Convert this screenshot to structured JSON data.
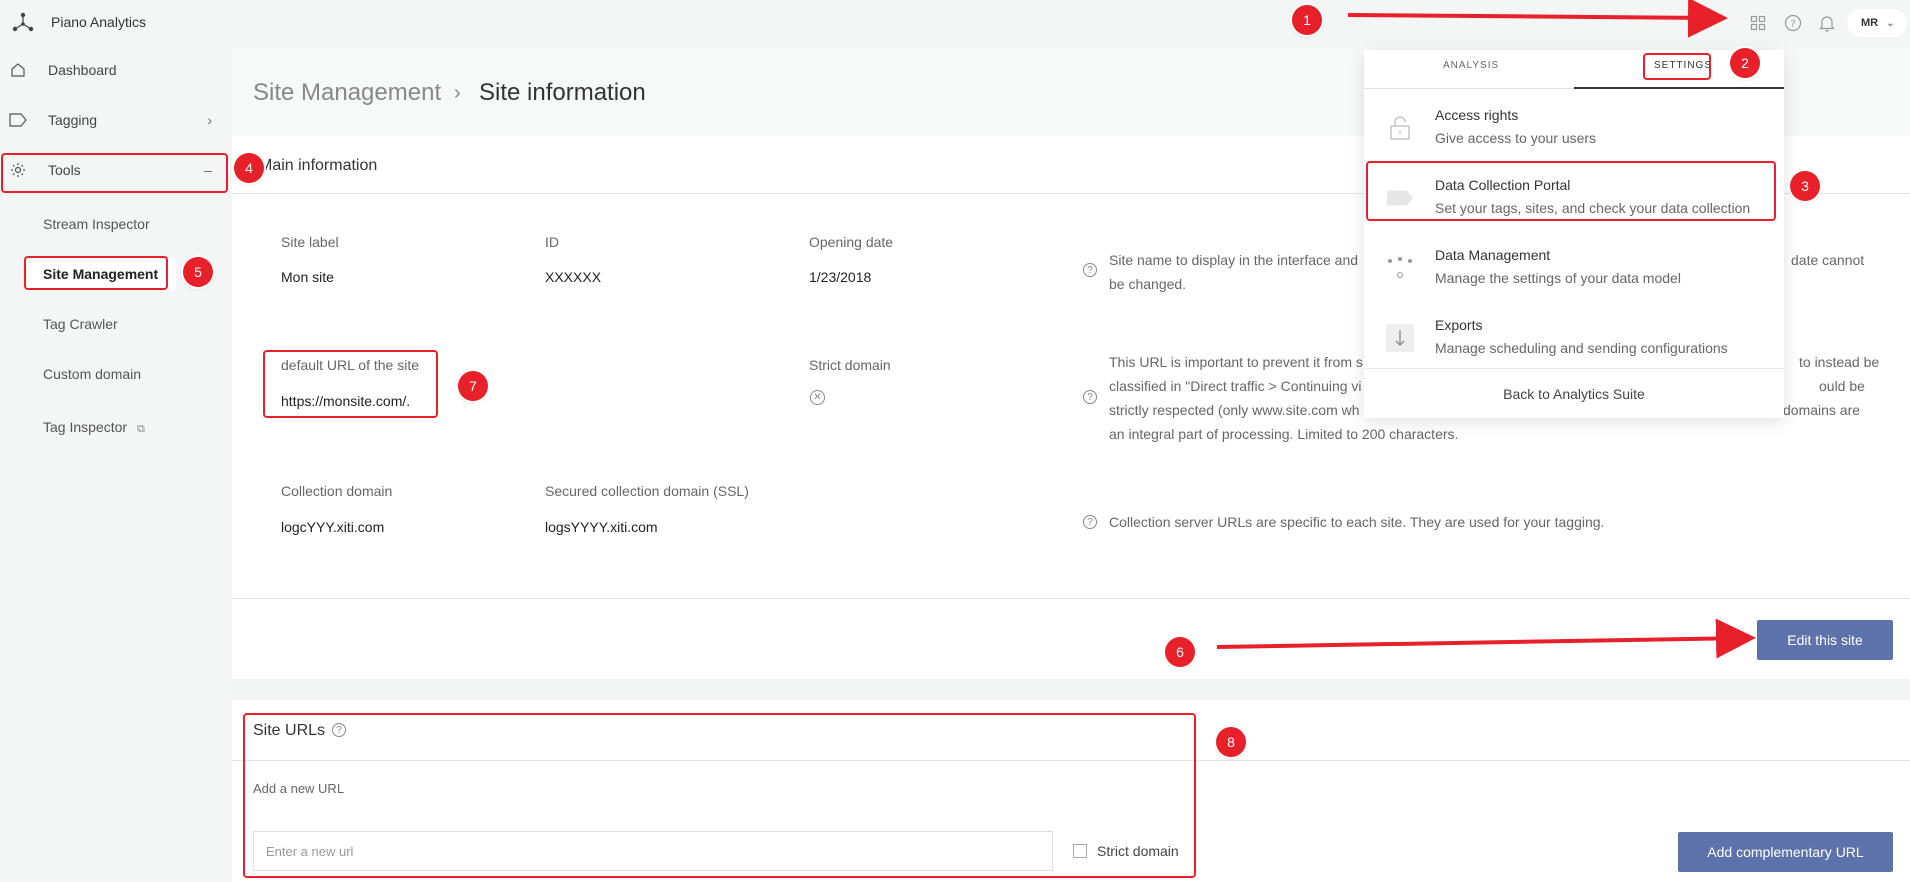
{
  "app": {
    "title": "Piano Analytics"
  },
  "topbar": {
    "icons": [
      "grid-icon",
      "help-icon",
      "bell-icon"
    ],
    "user_initials": "MR"
  },
  "sidebar": {
    "items": [
      {
        "label": "Dashboard",
        "icon": "home-icon"
      },
      {
        "label": "Tagging",
        "icon": "tag-icon",
        "right": "›"
      },
      {
        "label": "Tools",
        "icon": "gear-icon",
        "right": "–"
      }
    ],
    "sub_items": [
      {
        "label": "Stream Inspector"
      },
      {
        "label": "Site Management"
      },
      {
        "label": "Tag Crawler"
      },
      {
        "label": "Custom domain"
      },
      {
        "label": "Tag Inspector"
      }
    ]
  },
  "breadcrumb": {
    "parent": "Site Management",
    "separator": "›",
    "current": "Site information"
  },
  "main_info": {
    "title": "Main information",
    "site_label": {
      "label": "Site label",
      "value": "Mon site"
    },
    "id": {
      "label": "ID",
      "value": "XXXXXX"
    },
    "opening_date": {
      "label": "Opening date",
      "value": "1/23/2018"
    },
    "help1_line1": "Site name to display in the interface and",
    "help1_tail": "date cannot",
    "help1_line2": "be changed.",
    "default_url": {
      "label": "default URL of the site",
      "value": "https://monsite.com/."
    },
    "strict_domain_label": "Strict domain",
    "help2_lines": [
      "This URL is important to prevent it from s",
      "classified in \"Direct traffic > Continuing vi",
      "strictly respected (only www.site.com wh",
      "an integral part of processing. Limited to 200 characters."
    ],
    "help2_tails": [
      "to instead be",
      "ould be",
      "domains are"
    ],
    "collection_domain": {
      "label": "Collection domain",
      "value": "logcYYY.xiti.com"
    },
    "secured_domain": {
      "label": "Secured collection domain (SSL)",
      "value": "logsYYYY.xiti.com"
    },
    "help3": "Collection server URLs are specific to each site. They are used for your tagging.",
    "edit_button": "Edit this site"
  },
  "site_urls": {
    "title": "Site URLs",
    "add_label": "Add a new URL",
    "input_placeholder": "Enter a new url",
    "strict_domain_label": "Strict domain",
    "add_button": "Add complementary URL"
  },
  "dropdown": {
    "tabs": [
      "ANALYSIS",
      "SETTINGS"
    ],
    "items": [
      {
        "title": "Access rights",
        "desc": "Give access to your users",
        "icon": "lock-icon"
      },
      {
        "title": "Data Collection Portal",
        "desc": "Set your tags, sites, and check your data collection",
        "icon": "tag-label-icon"
      },
      {
        "title": "Data Management",
        "desc": "Manage the settings of your data model",
        "icon": "data-model-icon"
      },
      {
        "title": "Exports",
        "desc": "Manage scheduling and sending configurations",
        "icon": "download-icon"
      }
    ],
    "footer": "Back to Analytics Suite"
  },
  "annotations": [
    "1",
    "2",
    "3",
    "4",
    "5",
    "6",
    "7",
    "8"
  ],
  "colors": {
    "annotation": "#e8202a",
    "primary_button": "#5d72aa"
  }
}
